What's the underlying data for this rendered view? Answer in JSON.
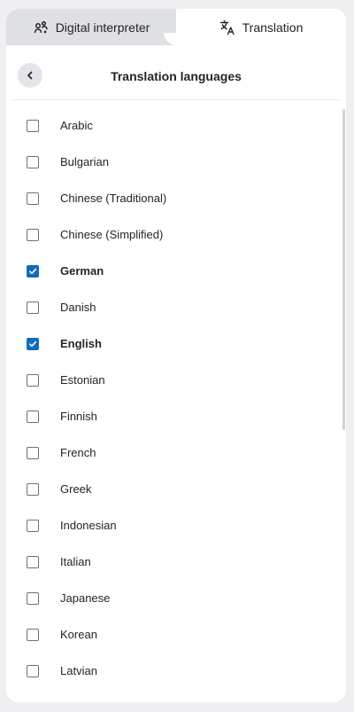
{
  "tabs": {
    "digital_interpreter": "Digital interpreter",
    "translation": "Translation",
    "active": "translation"
  },
  "header": {
    "title": "Translation languages",
    "back_icon": "chevron-left-icon"
  },
  "languages": [
    {
      "label": "Arabic",
      "checked": false
    },
    {
      "label": "Bulgarian",
      "checked": false
    },
    {
      "label": "Chinese (Traditional)",
      "checked": false
    },
    {
      "label": "Chinese (Simplified)",
      "checked": false
    },
    {
      "label": "German",
      "checked": true
    },
    {
      "label": "Danish",
      "checked": false
    },
    {
      "label": "English",
      "checked": true
    },
    {
      "label": "Estonian",
      "checked": false
    },
    {
      "label": "Finnish",
      "checked": false
    },
    {
      "label": "French",
      "checked": false
    },
    {
      "label": "Greek",
      "checked": false
    },
    {
      "label": "Indonesian",
      "checked": false
    },
    {
      "label": "Italian",
      "checked": false
    },
    {
      "label": "Japanese",
      "checked": false
    },
    {
      "label": "Korean",
      "checked": false
    },
    {
      "label": "Latvian",
      "checked": false
    }
  ],
  "colors": {
    "accent": "#0f6cbd",
    "inactive_tab": "#dfe0e4",
    "background": "#efeff1"
  }
}
